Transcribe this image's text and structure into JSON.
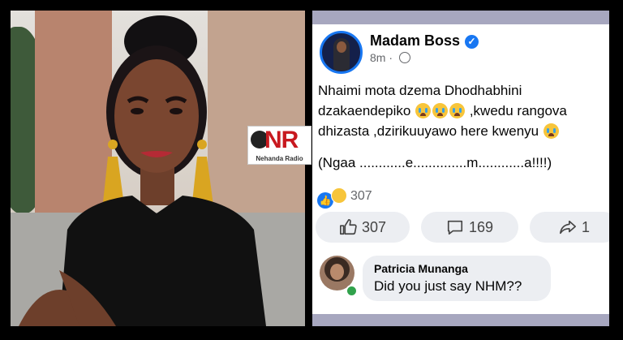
{
  "watermark": {
    "logo_text": "NR",
    "caption": "Nehanda Radio"
  },
  "post": {
    "author": "Madam Boss",
    "verified_icon": "check-icon",
    "time": "8m",
    "separator": "·",
    "privacy_icon": "globe-icon",
    "line1": "Nhaimi mota dzema Dhodhabhini",
    "line2_a": "dzakaendepiko",
    "line2_b": " ,kwedu rangova",
    "line3_a": "dhizasta  ,dzirikuuyawo here kwenyu",
    "line4": "(Ngaa ............e..............m............a!!!!)",
    "emoji_icon": "crying-face-icon"
  },
  "reactions": {
    "count": "307",
    "icons": [
      "like-icon",
      "haha-icon"
    ]
  },
  "actions": {
    "like_count": "307",
    "comment_count": "169",
    "share_count": "1"
  },
  "comment": {
    "name": "Patricia Munanga",
    "text": "Did you just say NHM??"
  },
  "colors": {
    "facebook_blue": "#1877f2",
    "button_bg": "#eceef2",
    "frame_bar": "#a7a7bf",
    "online_green": "#31a24c"
  }
}
